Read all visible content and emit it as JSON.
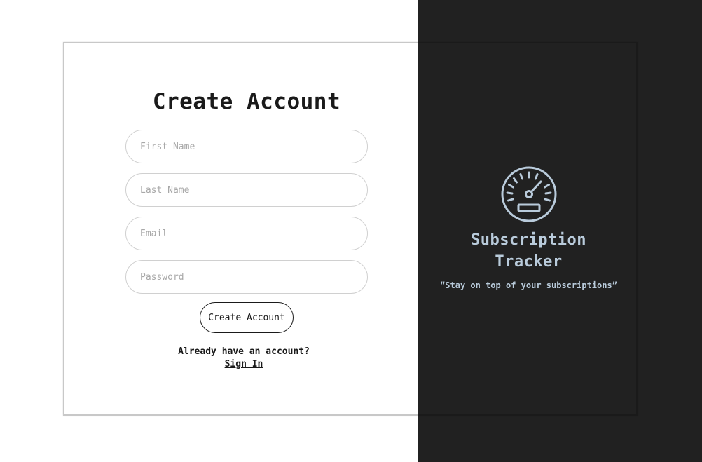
{
  "form": {
    "title": "Create Account",
    "fields": [
      {
        "placeholder": "First Name",
        "value": ""
      },
      {
        "placeholder": "Last Name",
        "value": ""
      },
      {
        "placeholder": "Email",
        "value": ""
      },
      {
        "placeholder": "Password",
        "value": ""
      }
    ],
    "submit_label": "Create Account",
    "signin_prompt": "Already have an account?",
    "signin_link": "Sign In"
  },
  "brand": {
    "icon": "speedometer-icon",
    "title_line1": "Subscription",
    "title_line2": "Tracker",
    "tagline": "“Stay on top of your subscriptions”"
  },
  "colors": {
    "dark_panel": "#212121",
    "accent": "#b9cbdb",
    "text": "#1a1a1a",
    "field_border": "#d0d0d0"
  }
}
